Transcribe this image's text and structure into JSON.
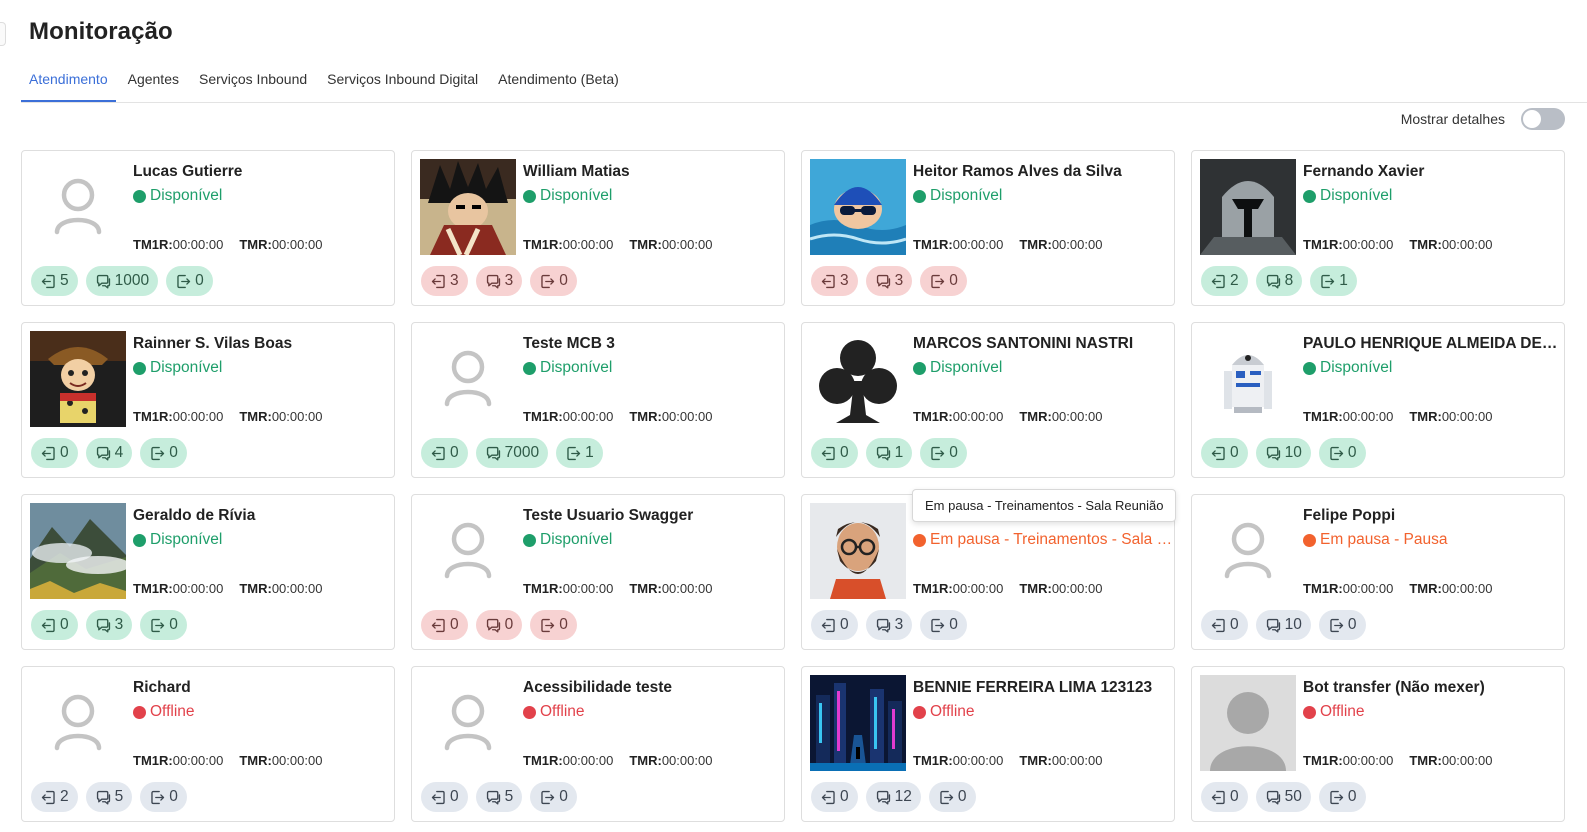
{
  "page": {
    "title": "Monitoração"
  },
  "tabs": [
    {
      "label": "Atendimento",
      "active": true
    },
    {
      "label": "Agentes",
      "active": false
    },
    {
      "label": "Serviços Inbound",
      "active": false
    },
    {
      "label": "Serviços Inbound Digital",
      "active": false
    },
    {
      "label": "Atendimento (Beta)",
      "active": false
    }
  ],
  "details_toggle": {
    "label": "Mostrar detalhes",
    "on": false
  },
  "colors": {
    "accent": "#3b6fd8",
    "available": "#1e9e6a",
    "paused": "#f2622e",
    "offline": "#e2424b",
    "pill_green": "#c6eddc",
    "pill_red": "#f7d2d2",
    "pill_grey": "#e3e8ef"
  },
  "metric_labels": {
    "tm1r": "TM1R:",
    "tmr": "TMR:"
  },
  "tooltip": {
    "text": "Em pausa - Treinamentos - Sala Reunião"
  },
  "agents": [
    {
      "name": "Lucas Gutierre",
      "status": "Disponível",
      "status_type": "available",
      "avatar": "default-user-icon",
      "tm1r": "00:00:00",
      "tmr": "00:00:00",
      "pill_style": "green",
      "counters": [
        "5",
        "1000",
        "0"
      ]
    },
    {
      "name": "William Matias",
      "status": "Disponível",
      "status_type": "available",
      "avatar": "anime-character-photo",
      "tm1r": "00:00:00",
      "tmr": "00:00:00",
      "pill_style": "red",
      "counters": [
        "3",
        "3",
        "0"
      ]
    },
    {
      "name": "Heitor Ramos Alves da Silva",
      "status": "Disponível",
      "status_type": "available",
      "avatar": "swimmer-photo",
      "tm1r": "00:00:00",
      "tmr": "00:00:00",
      "pill_style": "red",
      "counters": [
        "3",
        "3",
        "0"
      ]
    },
    {
      "name": "Fernando Xavier",
      "status": "Disponível",
      "status_type": "available",
      "avatar": "helmet-photo",
      "tm1r": "00:00:00",
      "tmr": "00:00:00",
      "pill_style": "green",
      "counters": [
        "2",
        "8",
        "1"
      ]
    },
    {
      "name": "Rainner S. Vilas Boas",
      "status": "Disponível",
      "status_type": "available",
      "avatar": "cowboy-toy-photo",
      "tm1r": "00:00:00",
      "tmr": "00:00:00",
      "pill_style": "green",
      "counters": [
        "0",
        "4",
        "0"
      ]
    },
    {
      "name": "Teste MCB 3",
      "status": "Disponível",
      "status_type": "available",
      "avatar": "default-user-icon",
      "tm1r": "00:00:00",
      "tmr": "00:00:00",
      "pill_style": "green",
      "counters": [
        "0",
        "7000",
        "1"
      ]
    },
    {
      "name": "MARCOS SANTONINI NASTRI",
      "status": "Disponível",
      "status_type": "available",
      "avatar": "club-suit-icon",
      "tm1r": "00:00:00",
      "tmr": "00:00:00",
      "pill_style": "green",
      "counters": [
        "0",
        "1",
        "0"
      ]
    },
    {
      "name": "PAULO HENRIQUE ALMEIDA DE SOUZA",
      "status": "Disponível",
      "status_type": "available",
      "avatar": "robot-toy-photo",
      "tm1r": "00:00:00",
      "tmr": "00:00:00",
      "pill_style": "green",
      "counters": [
        "0",
        "10",
        "0"
      ]
    },
    {
      "name": "Geraldo de Rívia",
      "status": "Disponível",
      "status_type": "available",
      "avatar": "mountain-landscape-photo",
      "tm1r": "00:00:00",
      "tmr": "00:00:00",
      "pill_style": "green",
      "counters": [
        "0",
        "3",
        "0"
      ]
    },
    {
      "name": "Teste Usuario Swagger",
      "status": "Disponível",
      "status_type": "available",
      "avatar": "default-user-icon",
      "tm1r": "00:00:00",
      "tmr": "00:00:00",
      "pill_style": "red",
      "counters": [
        "0",
        "0",
        "0"
      ]
    },
    {
      "name": "",
      "status": "Em pausa - Treinamentos - Sala Reunião",
      "status_type": "paused",
      "avatar": "bearded-man-avatar",
      "tm1r": "00:00:00",
      "tmr": "00:00:00",
      "pill_style": "grey",
      "counters": [
        "0",
        "3",
        "0"
      ]
    },
    {
      "name": "Felipe Poppi",
      "status": "Em pausa - Pausa",
      "status_type": "paused",
      "avatar": "default-user-icon",
      "tm1r": "00:00:00",
      "tmr": "00:00:00",
      "pill_style": "grey",
      "counters": [
        "0",
        "10",
        "0"
      ]
    },
    {
      "name": "Richard",
      "status": "Offline",
      "status_type": "offline",
      "avatar": "default-user-icon",
      "tm1r": "00:00:00",
      "tmr": "00:00:00",
      "pill_style": "grey",
      "counters": [
        "2",
        "5",
        "0"
      ]
    },
    {
      "name": "Acessibilidade teste",
      "status": "Offline",
      "status_type": "offline",
      "avatar": "default-user-icon",
      "tm1r": "00:00:00",
      "tmr": "00:00:00",
      "pill_style": "grey",
      "counters": [
        "0",
        "5",
        "0"
      ]
    },
    {
      "name": "BENNIE FERREIRA LIMA 123123",
      "status": "Offline",
      "status_type": "offline",
      "avatar": "cyberpunk-city-photo",
      "tm1r": "00:00:00",
      "tmr": "00:00:00",
      "pill_style": "grey",
      "counters": [
        "0",
        "12",
        "0"
      ]
    },
    {
      "name": "Bot transfer (Não mexer)",
      "status": "Offline",
      "status_type": "offline",
      "avatar": "grey-silhouette-avatar",
      "tm1r": "00:00:00",
      "tmr": "00:00:00",
      "pill_style": "grey",
      "counters": [
        "0",
        "50",
        "0"
      ]
    }
  ]
}
